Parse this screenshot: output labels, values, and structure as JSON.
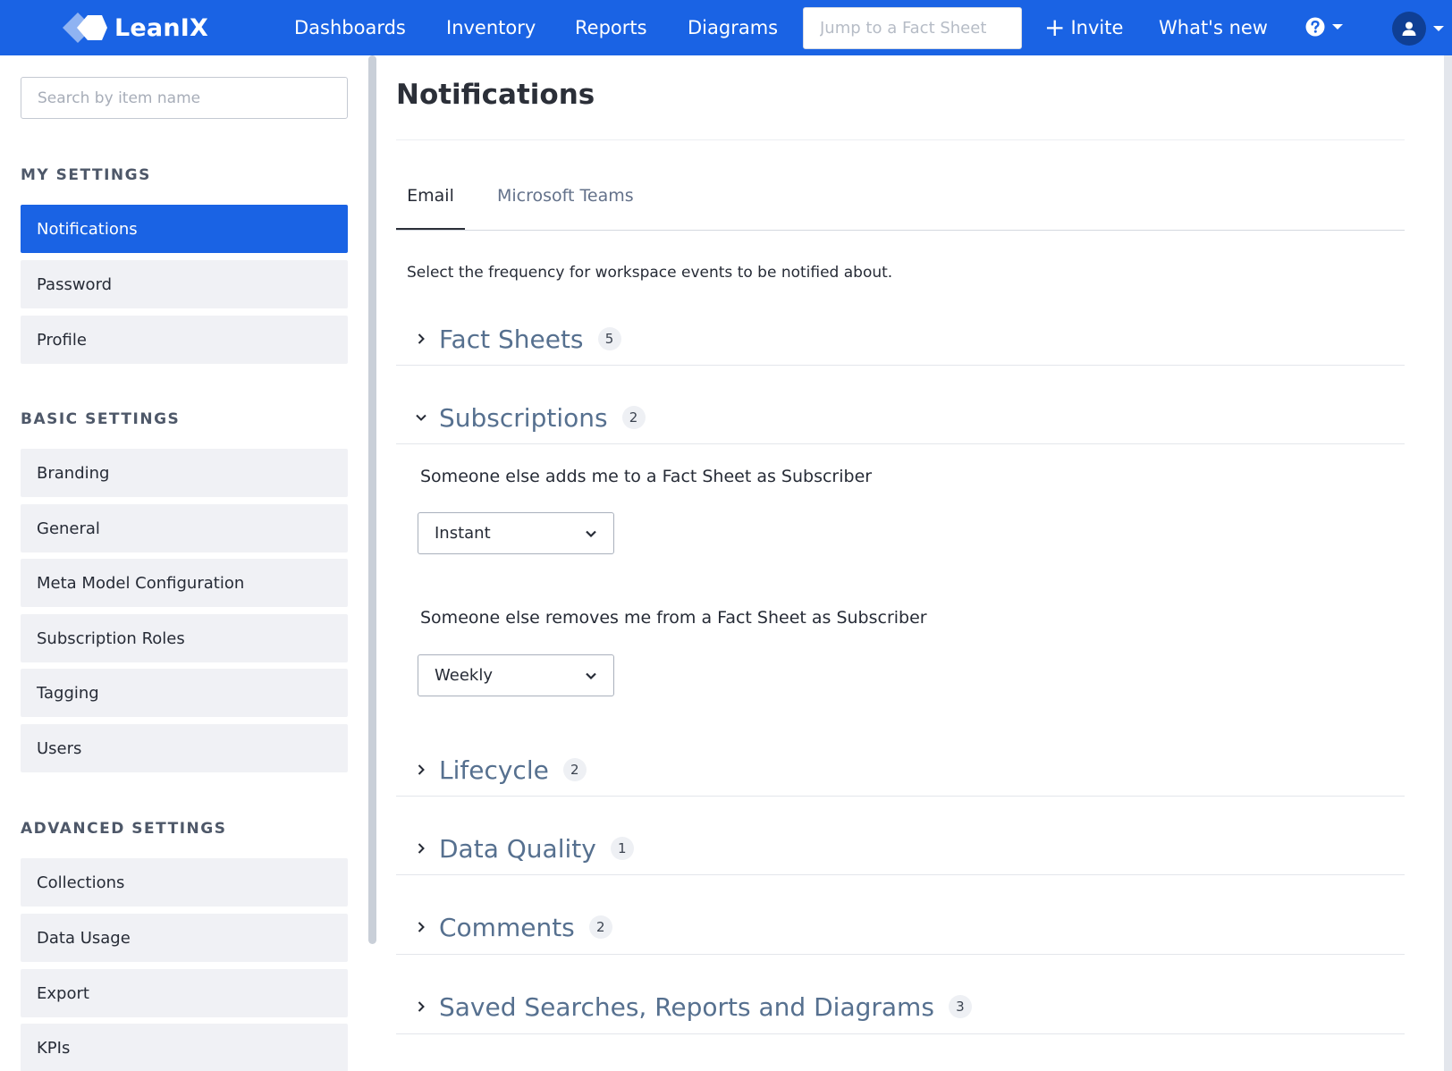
{
  "app": {
    "brand": "LeanIX",
    "colors": {
      "primary": "#1a63e4",
      "sectionText": "#56708f"
    }
  },
  "topnav": {
    "links": [
      "Dashboards",
      "Inventory",
      "Reports",
      "Diagrams"
    ],
    "jump_placeholder": "Jump to a Fact Sheet",
    "invite_label": "Invite",
    "whats_new_label": "What's new",
    "help_icon": "question-circle-icon",
    "user_icon": "user-icon"
  },
  "sidebar": {
    "search_placeholder": "Search by item name",
    "groups": [
      {
        "heading": "MY SETTINGS",
        "items": [
          "Notifications",
          "Password",
          "Profile"
        ]
      },
      {
        "heading": "BASIC SETTINGS",
        "items": [
          "Branding",
          "General",
          "Meta Model Configuration",
          "Subscription Roles",
          "Tagging",
          "Users"
        ]
      },
      {
        "heading": "ADVANCED SETTINGS",
        "items": [
          "Collections",
          "Data Usage",
          "Export",
          "KPIs"
        ]
      }
    ],
    "active_item": "Notifications"
  },
  "main": {
    "title": "Notifications",
    "tabs": [
      {
        "label": "Email",
        "active": true
      },
      {
        "label": "Microsoft Teams",
        "active": false
      }
    ],
    "intro": "Select the frequency for workspace events to be notified about.",
    "sections": [
      {
        "label": "Fact Sheets",
        "count": "5",
        "expanded": false
      },
      {
        "label": "Subscriptions",
        "count": "2",
        "expanded": true,
        "settings": [
          {
            "label": "Someone else adds me to a Fact Sheet as Subscriber",
            "value": "Instant"
          },
          {
            "label": "Someone else removes me from a Fact Sheet as Subscriber",
            "value": "Weekly"
          }
        ]
      },
      {
        "label": "Lifecycle",
        "count": "2",
        "expanded": false
      },
      {
        "label": "Data Quality",
        "count": "1",
        "expanded": false
      },
      {
        "label": "Comments",
        "count": "2",
        "expanded": false
      },
      {
        "label": "Saved Searches, Reports and Diagrams",
        "count": "3",
        "expanded": false
      }
    ]
  }
}
